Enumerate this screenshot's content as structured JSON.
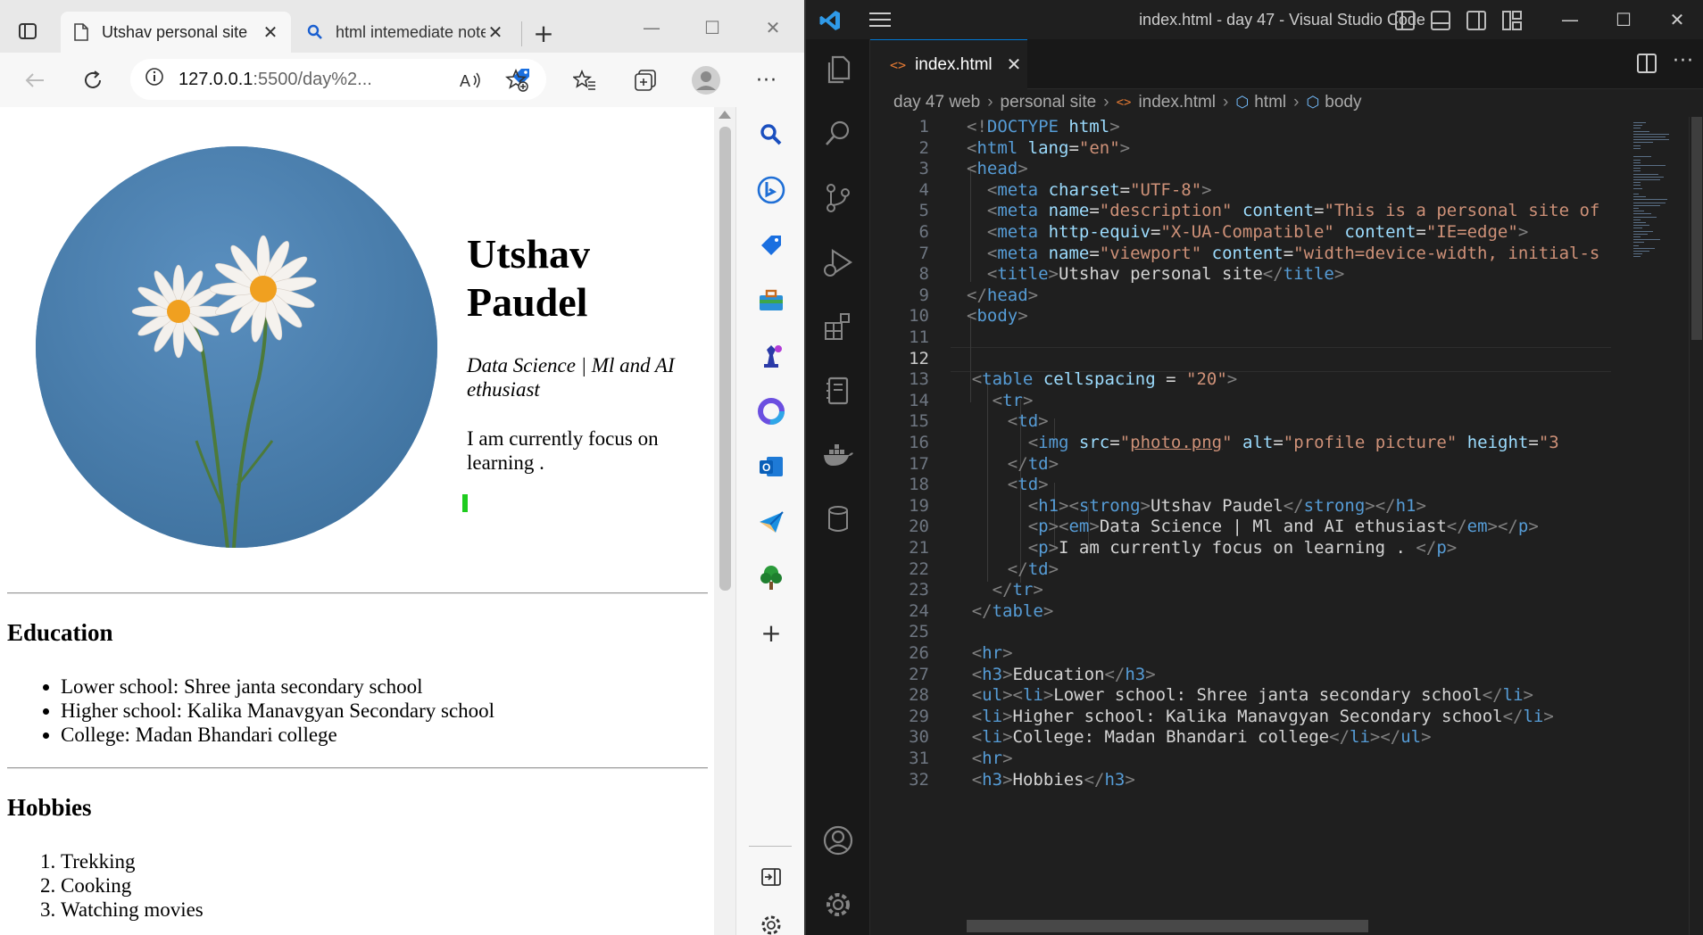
{
  "browser": {
    "tabs": [
      {
        "title": "Utshav personal site",
        "icon": "page-icon",
        "active": true
      },
      {
        "title": "html intemediate notes",
        "icon": "search-icon",
        "active": false
      }
    ],
    "address": {
      "host": "127.0.0.1",
      "path": ":5500/day%2..."
    },
    "page": {
      "name": "Utshav Paudel",
      "tagline": "Data Science | Ml and AI ethusiast",
      "focus": "I am currently focus on learning .",
      "education_heading": "Education",
      "education": [
        "Lower school: Shree janta secondary school",
        "Higher school: Kalika Manavgyan Secondary school",
        "College: Madan Bhandari college"
      ],
      "hobbies_heading": "Hobbies",
      "hobbies": [
        "Trekking",
        "Cooking",
        "Watching movies"
      ]
    },
    "sidebar_icons": [
      "search-icon",
      "bing-icon",
      "shopping-tag-icon",
      "tools-icon",
      "games-icon",
      "m365-icon",
      "outlook-icon",
      "send-icon",
      "tree-icon",
      "add-icon"
    ]
  },
  "vscode": {
    "window_title": "index.html - day 47 - Visual Studio Code",
    "tab_label": "index.html",
    "breadcrumb": [
      "day 47 web",
      "personal site",
      "index.html",
      "html",
      "body"
    ],
    "current_line": 12,
    "line_numbers": [
      "1",
      "2",
      "3",
      "4",
      "5",
      "6",
      "7",
      "8",
      "9",
      "10",
      "11",
      "12",
      "13",
      "14",
      "15",
      "16",
      "17",
      "18",
      "19",
      "20",
      "21",
      "22",
      "23",
      "24",
      "25",
      "26",
      "27",
      "28",
      "29",
      "30",
      "31",
      "32"
    ]
  },
  "colors": {
    "accent": "#0078d4",
    "tag": "#569cd6",
    "attribute": "#9cdcfe",
    "string": "#ce9178",
    "photo_sky": "#4a7fb0"
  }
}
